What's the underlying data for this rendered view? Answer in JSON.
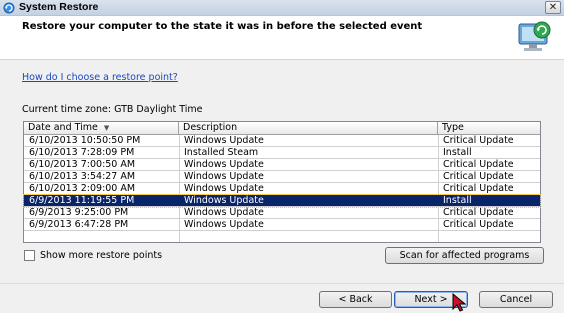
{
  "window": {
    "title": "System Restore",
    "close_symbol": "✕"
  },
  "header": {
    "text": "Restore your computer to the state it was in before the selected event",
    "icon": "system-restore-monitor-icon"
  },
  "help_link": "How do I choose a restore point?",
  "timezone_label": "Current time zone: GTB Daylight Time",
  "table": {
    "columns": [
      "Date and Time",
      "Description",
      "Type"
    ],
    "sort_indicator": "▼",
    "rows": [
      {
        "date": "6/10/2013 10:50:50 PM",
        "description": "Windows Update",
        "type": "Critical Update"
      },
      {
        "date": "6/10/2013 7:28:09 PM",
        "description": "Installed Steam",
        "type": "Install"
      },
      {
        "date": "6/10/2013 7:00:50 AM",
        "description": "Windows Update",
        "type": "Critical Update"
      },
      {
        "date": "6/10/2013 3:54:27 AM",
        "description": "Windows Update",
        "type": "Critical Update"
      },
      {
        "date": "6/10/2013 2:09:00 AM",
        "description": "Windows Update",
        "type": "Critical Update"
      },
      {
        "date": "6/9/2013 11:19:55 PM",
        "description": "Windows Update",
        "type": "Install",
        "selected": true
      },
      {
        "date": "6/9/2013 9:25:00 PM",
        "description": "Windows Update",
        "type": "Critical Update"
      },
      {
        "date": "6/9/2013 6:47:28 PM",
        "description": "Windows Update",
        "type": "Critical Update"
      }
    ]
  },
  "show_more": {
    "label": "Show more restore points",
    "checked": false
  },
  "buttons": {
    "scan": "Scan for affected programs",
    "back": "< Back",
    "next": "Next >",
    "cancel": "Cancel"
  },
  "colors": {
    "selection": "#0a246a",
    "link": "#1a49c2"
  }
}
